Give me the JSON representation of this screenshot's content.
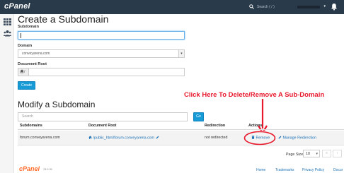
{
  "topbar": {
    "logo": "cPanel",
    "search_placeholder": "Search ( / )",
    "user_chevron": "▾"
  },
  "create": {
    "title": "Create a Subdomain",
    "subdomain_label": "Subdomain",
    "subdomain_value": "",
    "domain_label": "Domain",
    "domain_value": "conveyarena.com",
    "docroot_label": "Document Root",
    "docroot_prefix": "/",
    "docroot_value": "",
    "create_button": "Create"
  },
  "modify": {
    "title": "Modify a Subdomain",
    "search_placeholder": "Search",
    "go_button": "Go",
    "callout": "Click Here To Delete/Remove A Sub-Domain",
    "columns": [
      "Subdomains",
      "Document Root",
      "Redirection",
      "Actions"
    ],
    "rows": [
      {
        "subdomain": "forum.conveyarena.com",
        "docroot": "/public_html/forum.conveyarena.com",
        "redirection": "not redirected",
        "remove": "Remove",
        "manage": "Manage Redirection"
      }
    ],
    "page_size_label": "Page Size",
    "page_size_value": "10",
    "pager_first": "«",
    "pager_prev": "‹"
  },
  "footer": {
    "logo": "cPanel",
    "version": "78.0.35",
    "links": [
      "Home",
      "Trademarks",
      "Privacy Policy",
      "Docur"
    ]
  },
  "colors": {
    "topbar": "#293a4a",
    "accent": "#179bd7",
    "callout": "#e8192c",
    "footer_logo": "#ff6c2c"
  }
}
